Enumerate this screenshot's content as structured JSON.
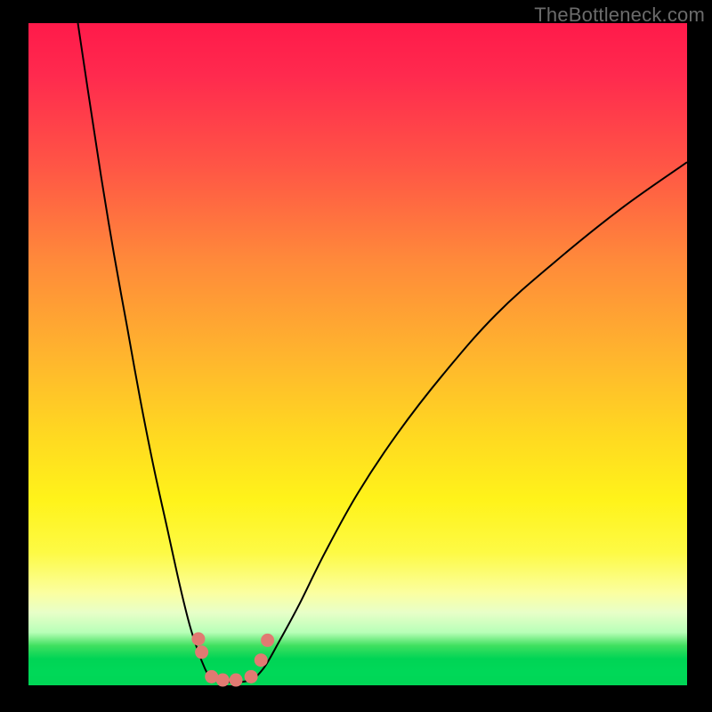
{
  "watermark": "TheBottleneck.com",
  "colors": {
    "frame": "#000000",
    "curve": "#000000",
    "marker_fill": "#e17a72",
    "marker_stroke": "#c85a52"
  },
  "chart_data": {
    "type": "line",
    "title": "",
    "xlabel": "",
    "ylabel": "",
    "xlim": [
      0,
      100
    ],
    "ylim": [
      0,
      100
    ],
    "annotations": [
      "gradient background from red (top) through orange/yellow to green (bottom)"
    ],
    "series": [
      {
        "name": "left-branch",
        "x": [
          7.5,
          9,
          11,
          13,
          15,
          17,
          19,
          21,
          23,
          24.5,
          25.8,
          26.8,
          27.5
        ],
        "y": [
          100,
          90,
          77,
          65,
          54,
          43,
          33,
          24,
          15,
          9,
          5,
          2.5,
          1.2
        ]
      },
      {
        "name": "valley-floor",
        "x": [
          27.5,
          29,
          31,
          33,
          34.5
        ],
        "y": [
          1.2,
          0.6,
          0.5,
          0.6,
          1.2
        ]
      },
      {
        "name": "right-branch",
        "x": [
          34.5,
          36,
          38,
          41,
          45,
          50,
          56,
          63,
          71,
          80,
          90,
          100
        ],
        "y": [
          1.2,
          3,
          6.5,
          12,
          20,
          29,
          38,
          47,
          56,
          64,
          72,
          79
        ]
      }
    ],
    "markers": {
      "name": "highlight-points",
      "points": [
        {
          "x": 25.8,
          "y": 7.0
        },
        {
          "x": 26.3,
          "y": 5.0
        },
        {
          "x": 27.8,
          "y": 1.3
        },
        {
          "x": 29.5,
          "y": 0.8
        },
        {
          "x": 31.5,
          "y": 0.8
        },
        {
          "x": 33.8,
          "y": 1.3
        },
        {
          "x": 35.3,
          "y": 3.8
        },
        {
          "x": 36.3,
          "y": 6.8
        }
      ]
    }
  }
}
